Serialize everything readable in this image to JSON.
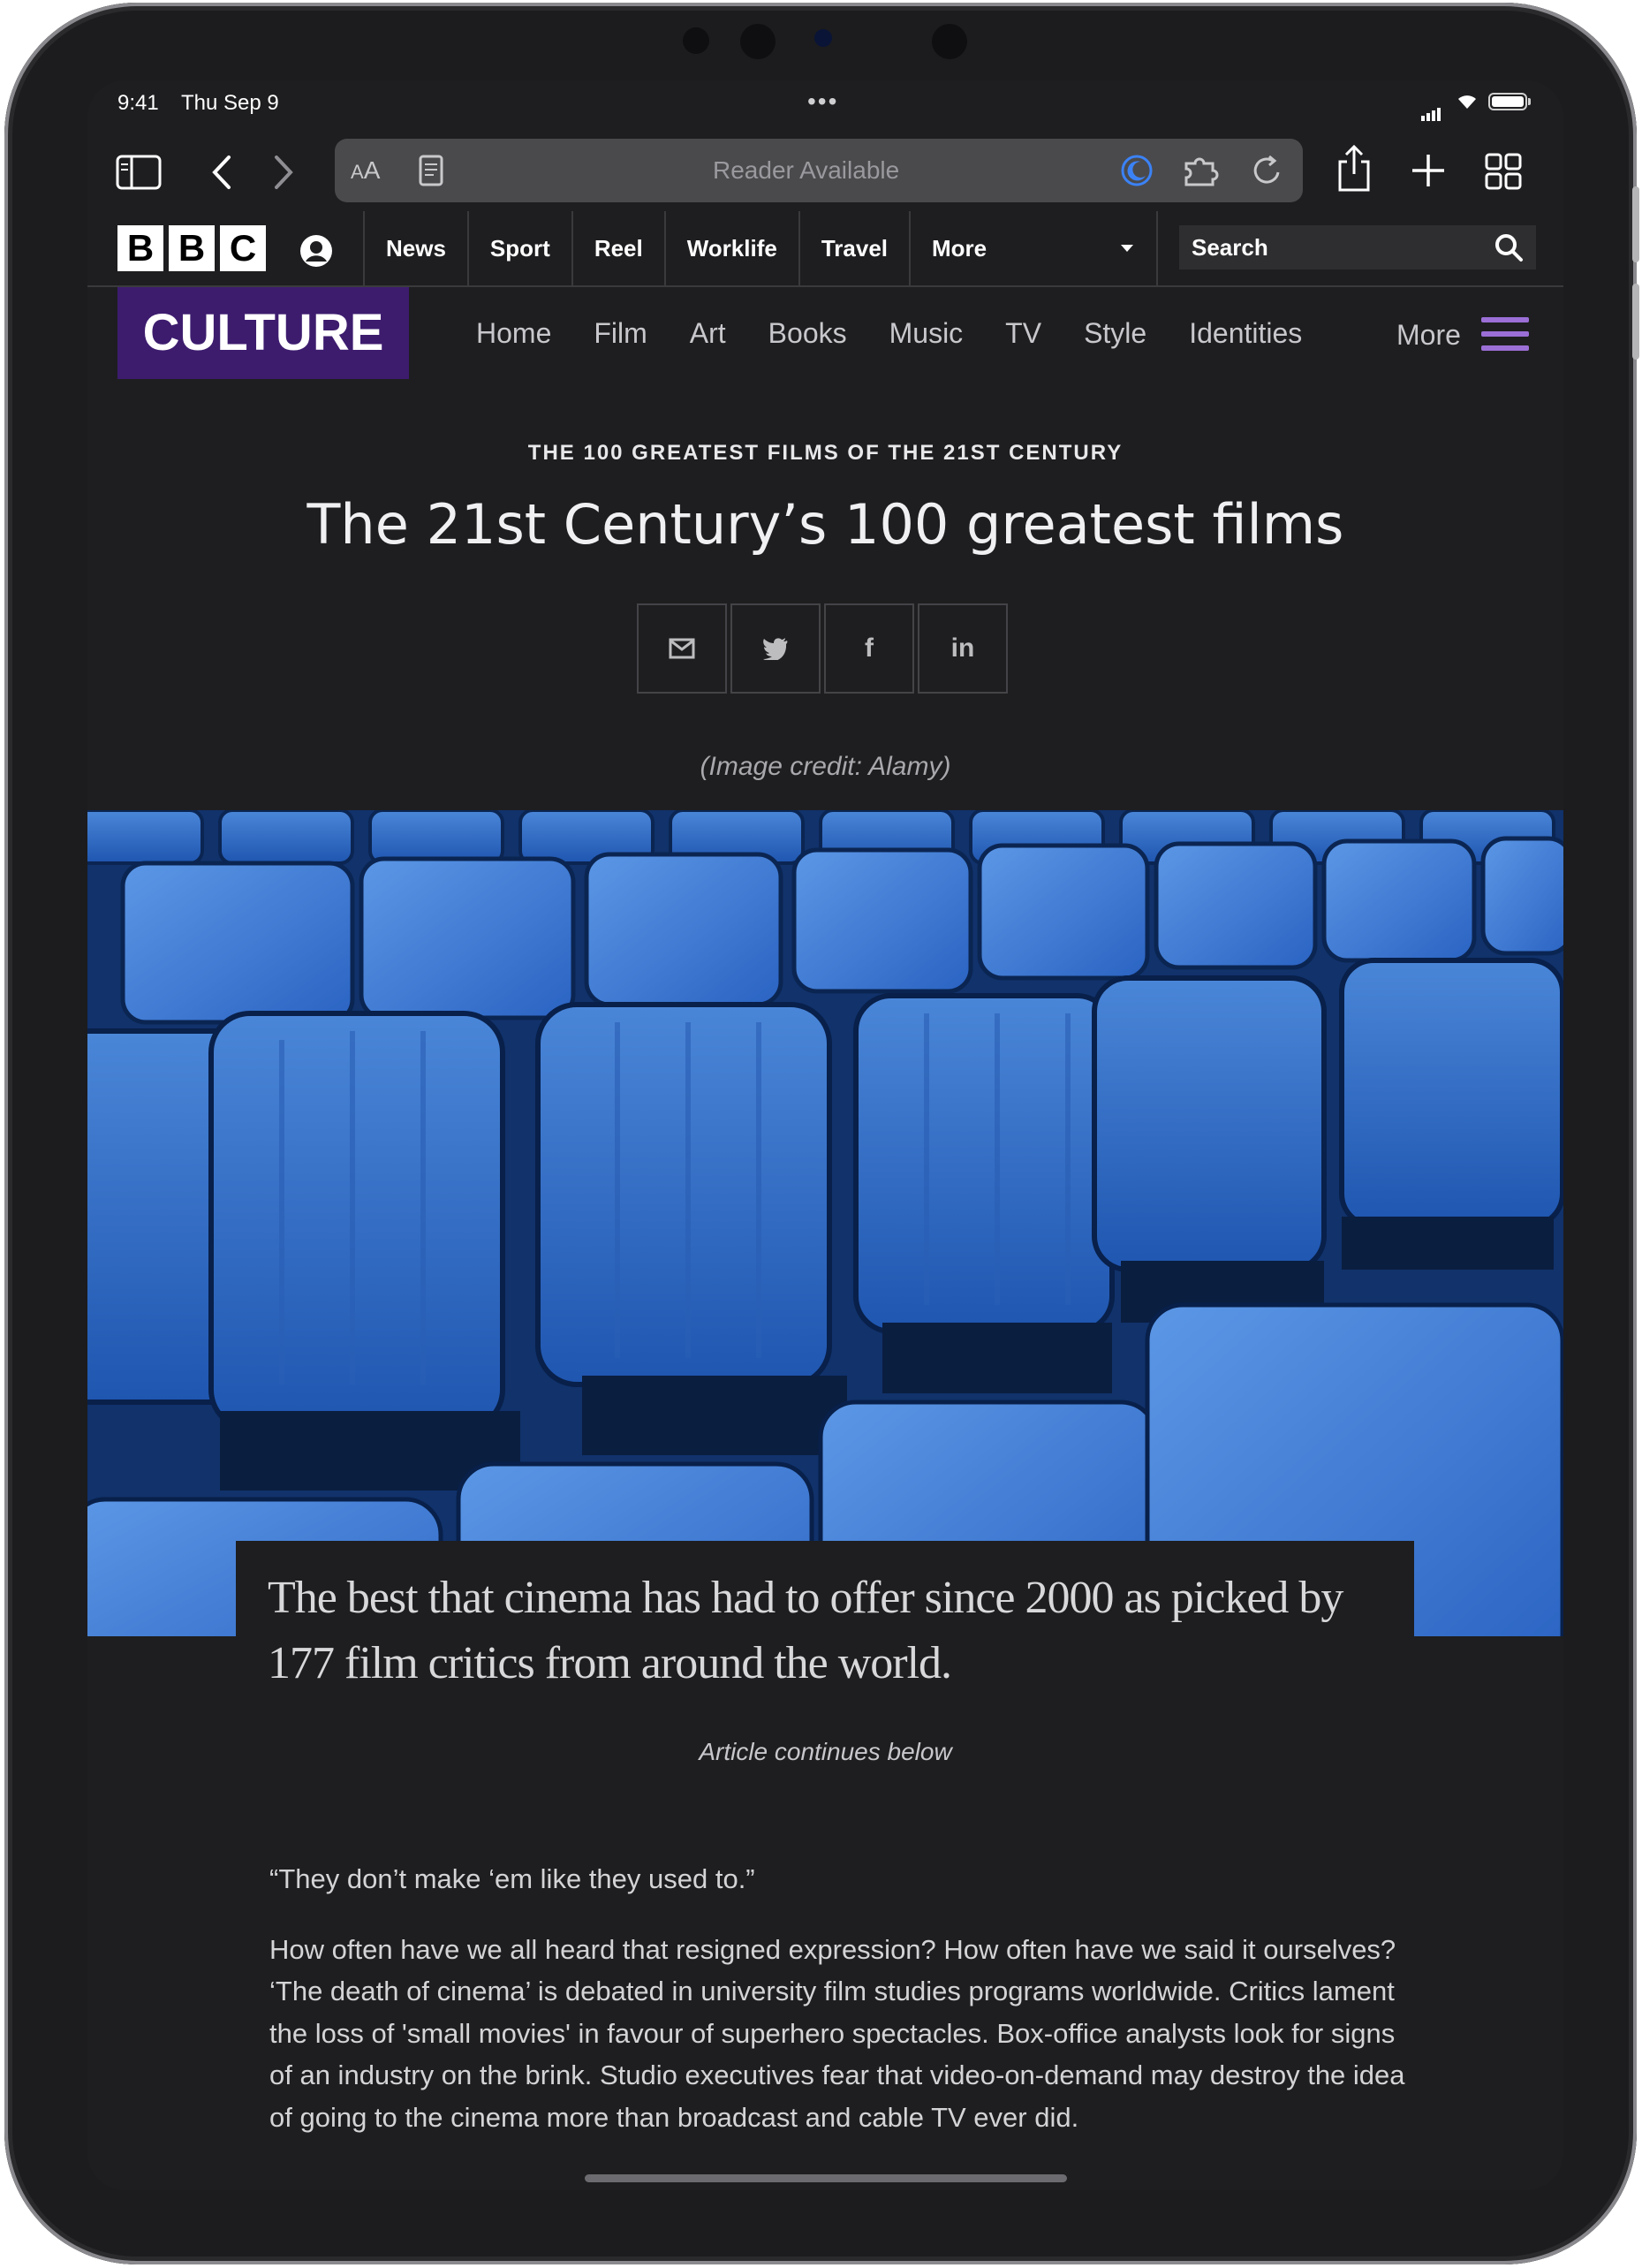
{
  "status_bar": {
    "time": "9:41",
    "date": "Thu Sep 9"
  },
  "safari": {
    "text_size_label_small": "A",
    "text_size_label_large": "A",
    "address_text": "Reader Available"
  },
  "bbc_header": {
    "logo_letters": [
      "B",
      "B",
      "C"
    ],
    "nav": [
      "News",
      "Sport",
      "Reel",
      "Worklife",
      "Travel"
    ],
    "more_label": "More",
    "search_placeholder": "Search"
  },
  "culture_header": {
    "section_title": "CULTURE",
    "nav": [
      "Home",
      "Film",
      "Art",
      "Books",
      "Music",
      "TV",
      "Style",
      "Identities"
    ],
    "more_label": "More",
    "accent_color": "#9b6fd6",
    "brand_color": "#3d1c6e"
  },
  "article": {
    "kicker": "THE 100 GREATEST FILMS OF THE 21ST CENTURY",
    "headline": "The 21st Century’s 100 greatest films",
    "share_buttons": [
      {
        "icon": "email-icon"
      },
      {
        "icon": "twitter-icon"
      },
      {
        "icon": "facebook-icon",
        "label": "f"
      },
      {
        "icon": "linkedin-icon",
        "label": "in"
      }
    ],
    "image_credit": "(Image credit: Alamy)",
    "standfirst": "The best that cinema has had to offer since 2000 as picked by 177 film critics from around the world.",
    "continues_note": "Article continues below",
    "paragraphs": [
      "“They don’t make ‘em like they used to.”",
      "How often have we all heard that resigned expression? How often have we said it ourselves? ‘The death of cinema’ is debated in university film studies programs worldwide. Critics lament the loss of 'small movies' in favour of superhero spectacles. Box-office analysts look for signs of an industry on the brink. Studio executives fear that video-on-demand may destroy the idea of going to the cinema more than broadcast and cable TV ever did."
    ]
  }
}
